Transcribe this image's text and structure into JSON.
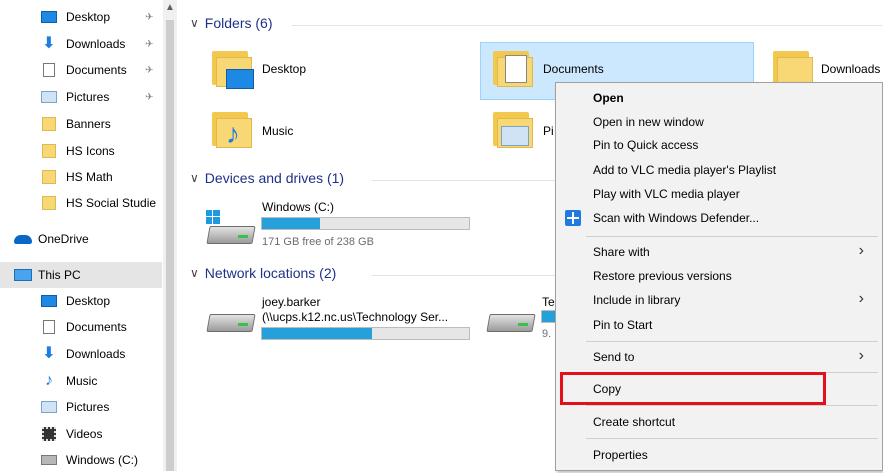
{
  "sidebar": {
    "quick_access": [
      {
        "label": "Desktop",
        "icon": "desktop-icon",
        "pinned": true
      },
      {
        "label": "Downloads",
        "icon": "downloads-icon",
        "pinned": true
      },
      {
        "label": "Documents",
        "icon": "documents-icon",
        "pinned": true
      },
      {
        "label": "Pictures",
        "icon": "pictures-icon",
        "pinned": true
      },
      {
        "label": "Banners",
        "icon": "folder-icon"
      },
      {
        "label": "HS Icons",
        "icon": "folder-icon"
      },
      {
        "label": "HS Math",
        "icon": "folder-icon"
      },
      {
        "label": "HS Social Studie",
        "icon": "folder-icon"
      }
    ],
    "onedrive": "OneDrive",
    "this_pc": "This PC",
    "this_pc_items": [
      {
        "label": "Desktop",
        "icon": "desktop-icon"
      },
      {
        "label": "Documents",
        "icon": "documents-icon"
      },
      {
        "label": "Downloads",
        "icon": "downloads-icon"
      },
      {
        "label": "Music",
        "icon": "music-icon"
      },
      {
        "label": "Pictures",
        "icon": "pictures-icon"
      },
      {
        "label": "Videos",
        "icon": "videos-icon"
      },
      {
        "label": "Windows (C:)",
        "icon": "drive-icon"
      }
    ],
    "pin_glyph": "📌"
  },
  "main": {
    "folders_header": "Folders (6)",
    "folders": [
      {
        "label": "Desktop"
      },
      {
        "label": "Documents"
      },
      {
        "label": "Downloads"
      },
      {
        "label": "Music"
      },
      {
        "label": "Pi"
      }
    ],
    "devices_header": "Devices and drives (1)",
    "drive": {
      "name": "Windows (C:)",
      "free": "171 GB free of 238 GB",
      "used_fraction": 0.28
    },
    "network_header": "Network locations (2)",
    "network": [
      {
        "name": "joey.barker",
        "path": "(\\\\ucps.k12.nc.us\\Technology Ser...",
        "used_fraction": 0.53
      },
      {
        "name": "Te",
        "path": "9.",
        "used_fraction": 0.5
      }
    ]
  },
  "context_menu": {
    "items": [
      {
        "label": "Open",
        "bold": true
      },
      {
        "label": "Open in new window"
      },
      {
        "label": "Pin to Quick access"
      },
      {
        "label": "Add to VLC media player's Playlist"
      },
      {
        "label": "Play with VLC media player"
      },
      {
        "label": "Scan with Windows Defender..."
      },
      {
        "label": "Share with",
        "submenu": true
      },
      {
        "label": "Restore previous versions"
      },
      {
        "label": "Include in library",
        "submenu": true
      },
      {
        "label": "Pin to Start"
      },
      {
        "label": "Send to",
        "submenu": true
      },
      {
        "label": "Copy"
      },
      {
        "label": "Create shortcut"
      },
      {
        "label": "Properties"
      }
    ],
    "highlighted_item": "Copy",
    "highlight_color": "#e3101a"
  }
}
